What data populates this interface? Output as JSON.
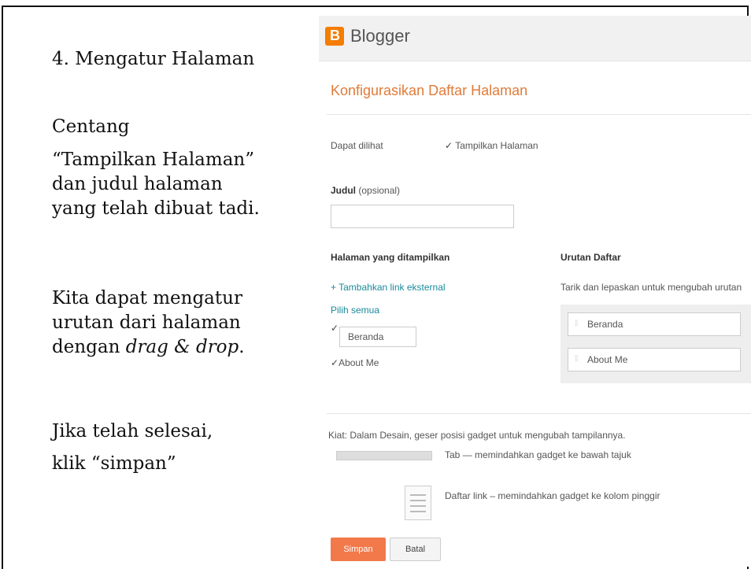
{
  "instructions": {
    "step_title": "4. Mengatur Halaman",
    "centang_line1": "Centang",
    "centang_line2": "“Tampilkan Halaman”",
    "centang_line3": "dan judul halaman",
    "centang_line4": "yang telah dibuat tadi.",
    "drag_line1": "Kita dapat mengatur",
    "drag_line2": "urutan dari halaman",
    "drag_line3_prefix": "dengan ",
    "drag_line3_italic": "drag & drop",
    "drag_line3_suffix": ".",
    "save_line1": "Jika telah selesai,",
    "save_line2": "klik “simpan”"
  },
  "blogger": {
    "app_name": "Blogger",
    "page_heading": "Konfigurasikan Daftar Halaman",
    "visible_label": "Dapat dilihat",
    "show_pages_checkbox": "Tampilkan Halaman",
    "title_label": "Judul",
    "title_optional": "(opsional)",
    "title_value": "",
    "pages_shown_heading": "Halaman yang ditampilkan",
    "order_heading": "Urutan Daftar",
    "add_external_link": "+ Tambahkan link eksternal",
    "order_hint": "Tarik dan lepaskan untuk mengubah urutan",
    "select_all": "Pilih semua",
    "pages": [
      {
        "label": "Beranda",
        "checked": true
      },
      {
        "label": "About Me",
        "checked": true
      }
    ],
    "order_items": [
      "Beranda",
      "About Me"
    ],
    "tip": "Kiat: Dalam Desain, geser posisi gadget untuk mengubah tampilannya.",
    "tab_option": "Tab — memindahkan gadget ke bawah tajuk",
    "list_option": "Daftar link – memindahkan gadget ke kolom pinggir",
    "save_button": "Simpan",
    "cancel_button": "Batal",
    "accent_color": "#f2794a",
    "link_color": "#1a8a9a"
  }
}
